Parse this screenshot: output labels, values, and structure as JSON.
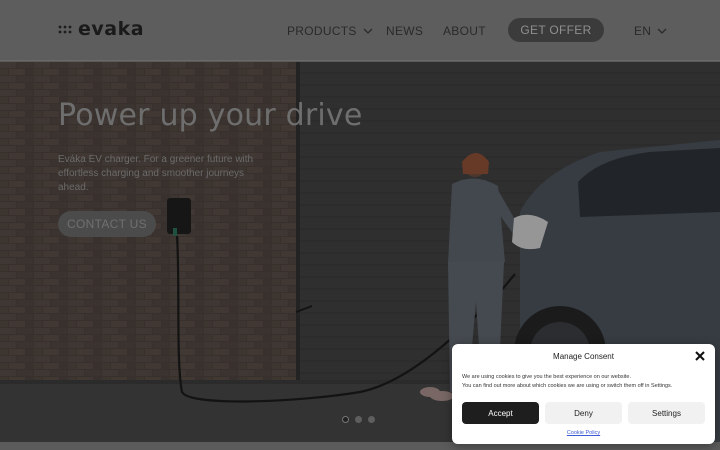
{
  "brand": {
    "name": "evaka"
  },
  "nav": {
    "products": "PRODUCTS",
    "news": "NEWS",
    "about": "ABOUT",
    "cta": "GET OFFER",
    "language": "EN"
  },
  "hero": {
    "title": "Power up your drive",
    "subtitle": "Eváka EV charger. For a greener future with effortless charging and smoother journeys ahead.",
    "cta": "CONTACT US",
    "slides": {
      "count": 3,
      "active": 1
    }
  },
  "cookie": {
    "title": "Manage Consent",
    "text_line1": "We are using cookies to give you the best experience on our website.",
    "text_line2": "You can find out more about which cookies we are using or switch them off in Settings.",
    "accept": "Accept",
    "deny": "Deny",
    "settings": "Settings",
    "policy": "Cookie Policy"
  },
  "icons": {
    "logo": "dots-logo-icon",
    "dropdown": "chevron-down-icon",
    "close": "close-icon"
  },
  "colors": {
    "overlay": "#5d5d5d",
    "accept_bg": "#1e1e1e",
    "policy_link": "#3b5bd6"
  }
}
